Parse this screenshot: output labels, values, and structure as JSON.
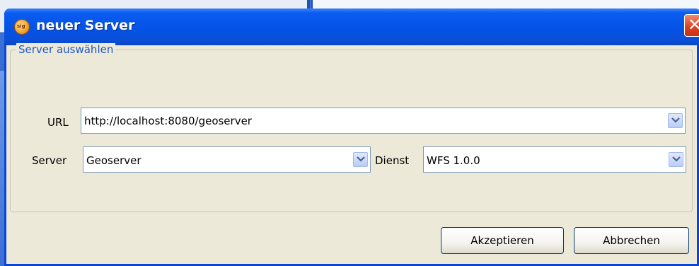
{
  "window": {
    "title": "neuer Server",
    "close_glyph": "✕"
  },
  "group": {
    "legend": "Server auswählen"
  },
  "fields": {
    "url_label": "URL",
    "url_value": "http://localhost:8080/geoserver",
    "server_label": "Server",
    "server_value": "Geoserver",
    "dienst_label": "Dienst",
    "dienst_value": "WFS 1.0.0"
  },
  "buttons": {
    "accept": "Akzeptieren",
    "cancel": "Abbrechen"
  },
  "icons": {
    "app": "globe-app-icon",
    "dropdown": "chevron-down-icon",
    "close": "close-icon"
  },
  "colors": {
    "titlebar": "#0552e6",
    "dialog_bg": "#ece9d8",
    "legend_text": "#1f58c6",
    "close_button": "#d9411f"
  }
}
